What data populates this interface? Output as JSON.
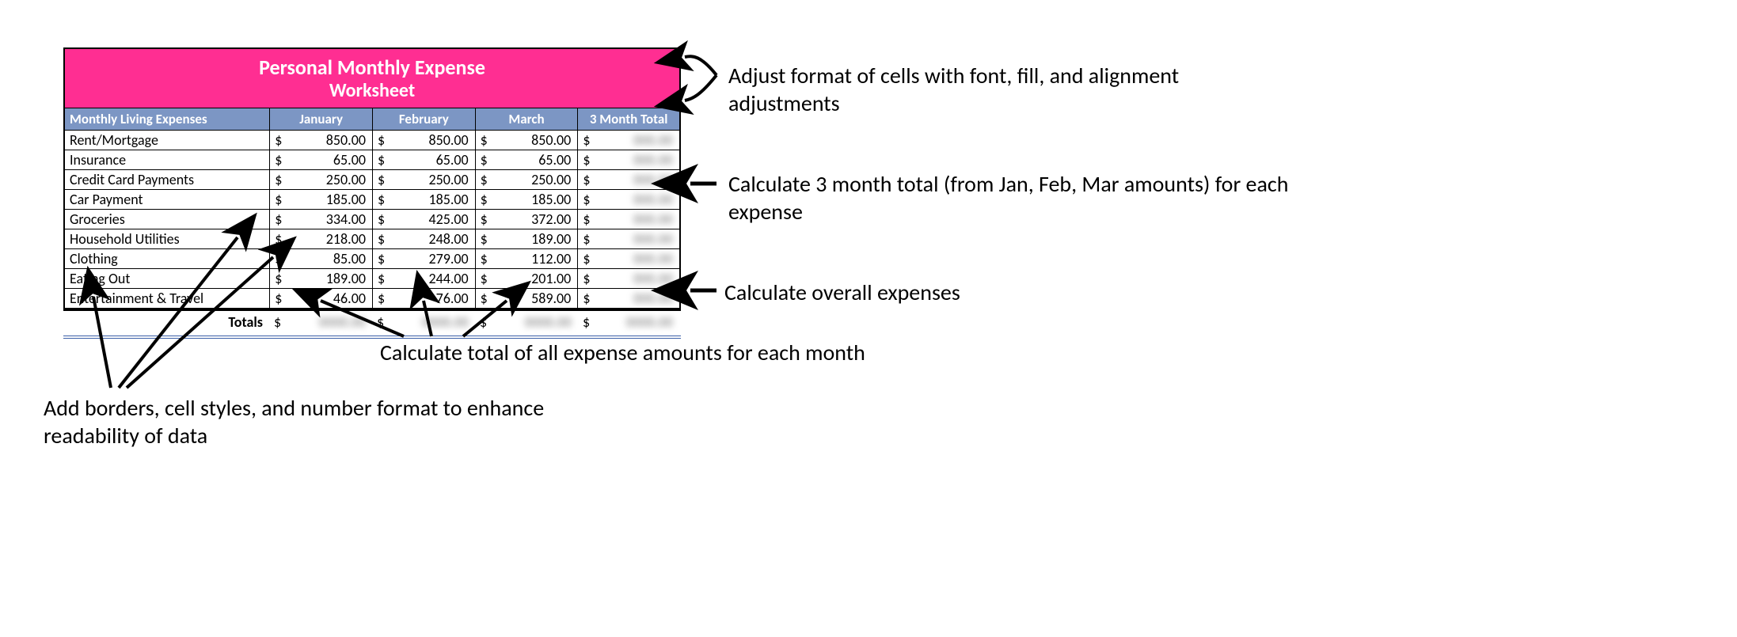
{
  "title": {
    "line1": "Personal Monthly Expense",
    "line2": "Worksheet"
  },
  "headers": {
    "label": "Monthly Living Expenses",
    "m1": "January",
    "m2": "February",
    "m3": "March",
    "total": "3 Month Total"
  },
  "currency_symbol": "$",
  "rows": [
    {
      "label": "Rent/Mortgage",
      "jan": "850.00",
      "feb": "850.00",
      "mar": "850.00"
    },
    {
      "label": "Insurance",
      "jan": "65.00",
      "feb": "65.00",
      "mar": "65.00"
    },
    {
      "label": "Credit Card Payments",
      "jan": "250.00",
      "feb": "250.00",
      "mar": "250.00"
    },
    {
      "label": "Car Payment",
      "jan": "185.00",
      "feb": "185.00",
      "mar": "185.00"
    },
    {
      "label": "Groceries",
      "jan": "334.00",
      "feb": "425.00",
      "mar": "372.00"
    },
    {
      "label": "Household Utilities",
      "jan": "218.00",
      "feb": "248.00",
      "mar": "189.00"
    },
    {
      "label": "Clothing",
      "jan": "85.00",
      "feb": "279.00",
      "mar": "112.00"
    },
    {
      "label": "Eating Out",
      "jan": "189.00",
      "feb": "244.00",
      "mar": "201.00"
    },
    {
      "label": "Entertainment & Travel",
      "jan": "46.00",
      "feb": "76.00",
      "mar": "589.00"
    }
  ],
  "totals_label": "Totals",
  "callouts": {
    "format": "Adjust format of cells with font, fill, and alignment adjustments",
    "threemonth": "Calculate 3 month total (from Jan, Feb, Mar amounts) for each expense",
    "overall": "Calculate overall expenses",
    "monthtotal": "Calculate total of all expense amounts for each month",
    "borders": "Add borders, cell styles, and number format to enhance readability of data"
  }
}
